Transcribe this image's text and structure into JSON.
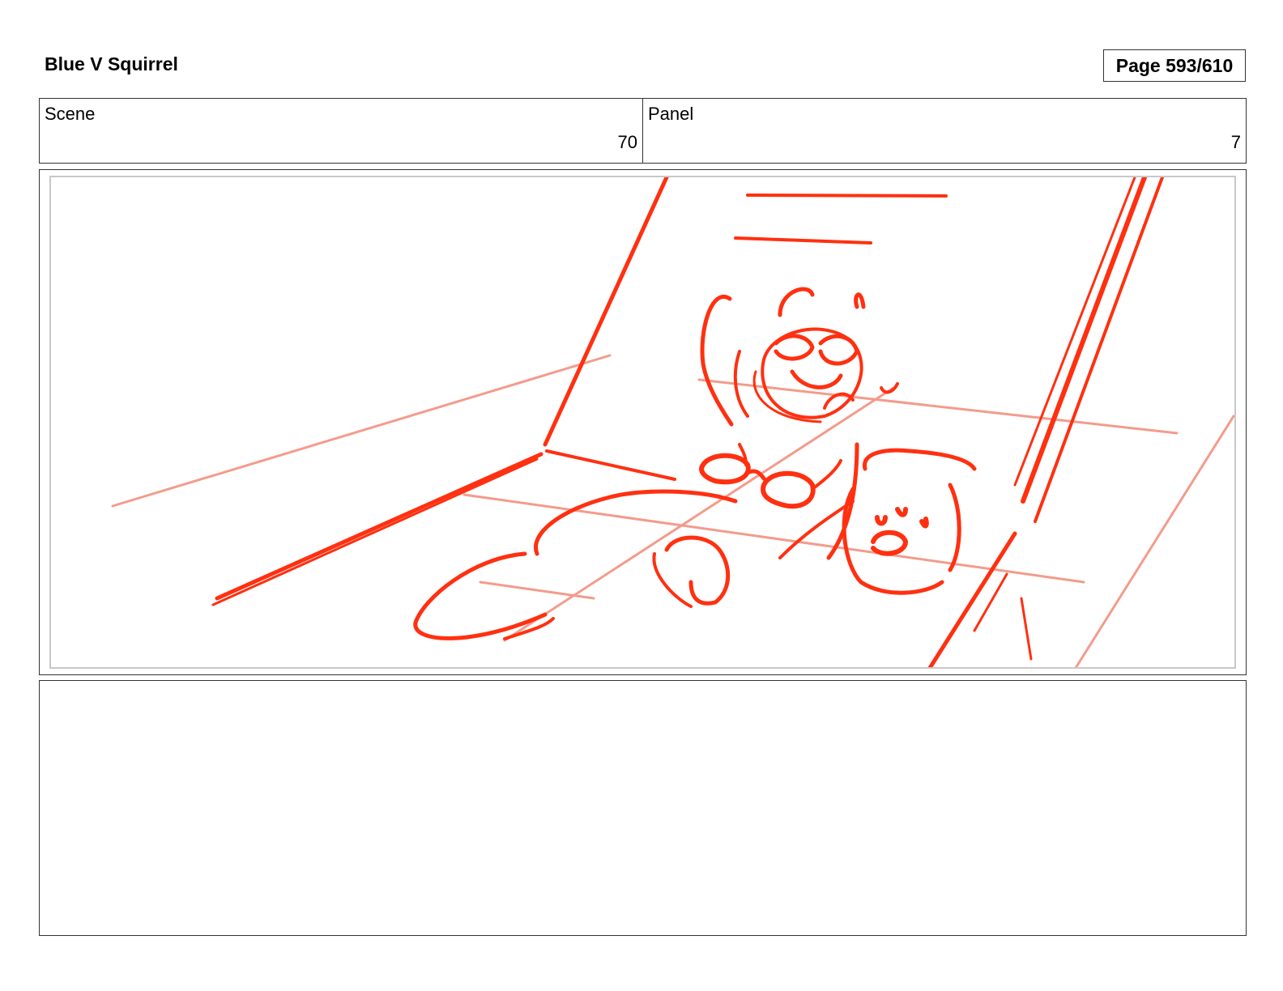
{
  "header": {
    "title": "Blue V Squirrel",
    "page_label": "Page 593/610"
  },
  "info": {
    "scene_label": "Scene",
    "scene_value": "70",
    "panel_label": "Panel",
    "panel_value": "7"
  },
  "panel": {
    "sketch_color": "#ff3010",
    "guide_color": "#f28a78"
  },
  "notes": {
    "text": ""
  }
}
